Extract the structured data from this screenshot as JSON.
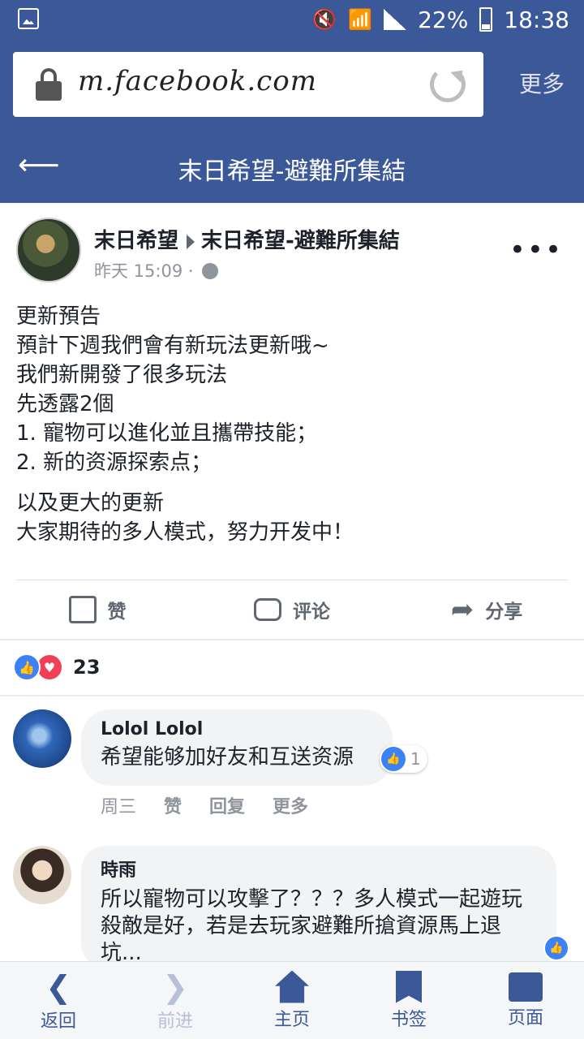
{
  "status_bar": {
    "battery": "22%",
    "time": "18:38"
  },
  "browser": {
    "url": "m.facebook.com",
    "more_label": "更多"
  },
  "header": {
    "title": "末日希望-避難所集結"
  },
  "post": {
    "author": "末日希望",
    "group": "末日希望-避難所集結",
    "time": "昨天 15:09",
    "separator": "·",
    "body_lines": [
      "更新預告",
      "預計下週我們會有新玩法更新哦~",
      "我們新開發了很多玩法",
      "先透露2個",
      "1. 寵物可以進化並且攜帶技能；",
      "2. 新的资源探索点；"
    ],
    "body_lines_2": [
      "以及更大的更新",
      "大家期待的多人模式，努力开发中！"
    ],
    "actions": {
      "like": "赞",
      "comment": "评论",
      "share": "分享"
    },
    "reaction_count": "23"
  },
  "comments": [
    {
      "name": "Lolol Lolol",
      "text": "希望能够加好友和互送资源",
      "like_count": "1",
      "date": "周三",
      "like_label": "赞",
      "reply_label": "回复",
      "more_label": "更多"
    },
    {
      "name": "時雨",
      "text": "所以寵物可以攻擊了？？？多人模式一起遊玩殺敵是好，若是去玩家避難所搶資源馬上退坑..."
    }
  ],
  "bottom_nav": {
    "back": "返回",
    "forward": "前进",
    "home": "主页",
    "bookmarks": "书签",
    "pages": "页面"
  },
  "colors": {
    "brand": "#3b5998",
    "like_blue": "#3b82f6",
    "love_red": "#f33e58"
  }
}
